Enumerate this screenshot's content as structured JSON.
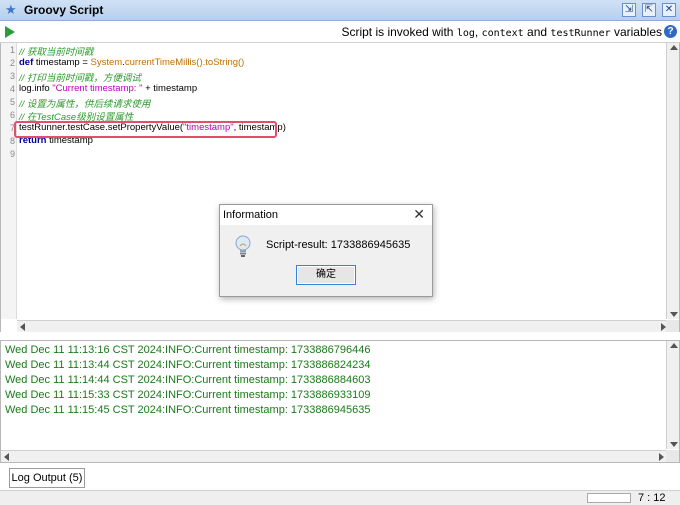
{
  "window": {
    "title": "Groovy Script",
    "buttons": {
      "detach": "⇲",
      "maximize": "⇱",
      "close": "✕"
    }
  },
  "toolbar": {
    "run_icon": "play-icon",
    "invoke_prefix": "Script is invoked with ",
    "invoke_var1": "log",
    "invoke_sep1": ", ",
    "invoke_var2": "context",
    "invoke_sep2": " and ",
    "invoke_var3": "testRunner",
    "invoke_suffix": " variables",
    "help_label": "?"
  },
  "editor": {
    "line_numbers": [
      "1",
      "2",
      "3",
      "4",
      "5",
      "6",
      "7",
      "8",
      "9"
    ],
    "lines": {
      "l1": "// 获取当前时间戳",
      "l2_kw": "def",
      "l2_a": " timestamp = ",
      "l2_cls": "System",
      "l2_b": ".",
      "l2_m": "currentTimeMillis().toString()",
      "l3": "// 打印当前时间戳，方便调试",
      "l4_a": "log.info ",
      "l4_str": "\"Current timestamp: \"",
      "l4_b": " + timestamp",
      "l5": "// 设置为属性，供后续请求使用",
      "l6": "// 在TestCase级别设置属性",
      "l7_a": "testRunner.testCase.setPropertyValue(",
      "l7_str": "\"timestamp\"",
      "l7_b": ", timestamp)",
      "l8_kw": "return",
      "l8_a": " timestamp"
    }
  },
  "dialog": {
    "title": "Information",
    "close_label": "✕",
    "message": "Script-result: 1733886945635",
    "ok_label": "确定"
  },
  "log": {
    "lines": [
      "Wed Dec 11 11:13:16 CST 2024:INFO:Current timestamp: 1733886796446",
      "Wed Dec 11 11:13:44 CST 2024:INFO:Current timestamp: 1733886824234",
      "Wed Dec 11 11:14:44 CST 2024:INFO:Current timestamp: 1733886884603",
      "Wed Dec 11 11:15:33 CST 2024:INFO:Current timestamp: 1733886933109",
      "Wed Dec 11 11:15:45 CST 2024:INFO:Current timestamp: 1733886945635"
    ],
    "tab_label": "Log Output (5)"
  },
  "status": {
    "position": "7 : 12"
  },
  "colors": {
    "log_text": "#1a7a1a",
    "highlight": "#e0506a",
    "title_bg": "#b7d0ec"
  }
}
